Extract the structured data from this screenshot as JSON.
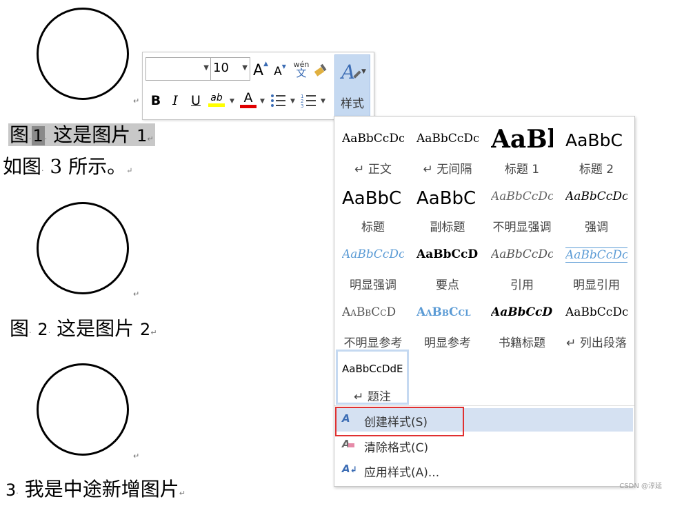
{
  "document": {
    "caption1": {
      "prefix": "图",
      "num": "1",
      "text": "这是图片",
      "suffix": "1"
    },
    "line2": {
      "prefix": "如图",
      "num": "3",
      "text": "所示。"
    },
    "caption2": {
      "prefix": "图",
      "num": "2",
      "text": "这是图片",
      "suffix": "2"
    },
    "caption3": {
      "num": "3",
      "text": "我是中途新增图片"
    },
    "para_mark": "↵",
    "space_mark": "·"
  },
  "mini_toolbar": {
    "font_name_value": "",
    "font_size_value": "10",
    "grow_font": "A",
    "shrink_font": "A",
    "phonetic_top": "wén",
    "phonetic_bottom": "文",
    "bold": "B",
    "italic": "I",
    "underline": "U",
    "highlight": "ab",
    "font_color": "A",
    "styles_label": "样式",
    "highlight_color": "#ffff00",
    "font_color_bar": "#e00000"
  },
  "style_gallery": {
    "styles": [
      {
        "preview": "AaBbCcDc",
        "name": "↵ 正文"
      },
      {
        "preview": "AaBbCcDc",
        "name": "↵ 无间隔"
      },
      {
        "preview": "AaBl",
        "name": "标题 1"
      },
      {
        "preview": "AaBbC",
        "name": "标题 2"
      },
      {
        "preview": "AaBbC",
        "name": "标题"
      },
      {
        "preview": "AaBbC",
        "name": "副标题"
      },
      {
        "preview": "AaBbCcDc",
        "name": "不明显强调"
      },
      {
        "preview": "AaBbCcDc",
        "name": "强调"
      },
      {
        "preview": "AaBbCcDc",
        "name": "明显强调"
      },
      {
        "preview": "AaBbCcD",
        "name": "要点"
      },
      {
        "preview": "AaBbCcDc",
        "name": "引用"
      },
      {
        "preview": "AaBbCcDc",
        "name": "明显引用"
      },
      {
        "preview": "AaBbCcD",
        "name": "不明显参考"
      },
      {
        "preview": "AaBbCcl",
        "name": "明显参考"
      },
      {
        "preview": "AaBbCcD",
        "name": "书籍标题"
      },
      {
        "preview": "AaBbCcDc",
        "name": "↵ 列出段落"
      },
      {
        "preview": "AaBbCcDdE",
        "name": "↵ 题注"
      }
    ],
    "menu": [
      {
        "label": "创建样式(S)",
        "icon": "create-style-icon"
      },
      {
        "label": "清除格式(C)",
        "icon": "clear-format-icon"
      },
      {
        "label": "应用样式(A)...",
        "icon": "apply-style-icon"
      }
    ],
    "accent_color": "#5b9bd5",
    "highlight_color": "#d5e1f2",
    "red_box_color": "#e03030"
  },
  "watermark": "CSDN @淳延"
}
